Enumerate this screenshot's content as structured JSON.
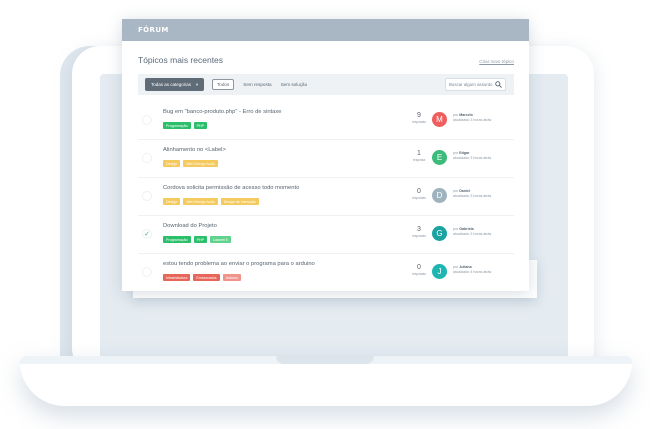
{
  "forum": {
    "title": "FÓRUM",
    "heading": "Tópicos mais recentes",
    "new_topic_link": "Criar novo tópico",
    "toolbar": {
      "category_select": "Todas as categorias",
      "filters": [
        "Todos",
        "Sem resposta",
        "Sem solução"
      ],
      "search_placeholder": "Buscar algum assunto"
    },
    "topics": [
      {
        "title": "Bug em \"banco-produto.php\" - Erro de sintaxe",
        "solved": false,
        "tags": [
          {
            "label": "Programação",
            "color": "#2bbf6a"
          },
          {
            "label": "PHP",
            "color": "#2bbf6a"
          }
        ],
        "count": "9",
        "count_label": "respostas",
        "avatar_letter": "M",
        "avatar_color": "#ef5e5e",
        "by_prefix": "por",
        "author": "Marcelo",
        "updated": "atualizado 3 horas atrás"
      },
      {
        "title": "Alinhamento no <Label>",
        "solved": false,
        "tags": [
          {
            "label": "Design",
            "color": "#f4c95d"
          },
          {
            "label": "Web Design Ação",
            "color": "#f4c95d"
          }
        ],
        "count": "1",
        "count_label": "resposta",
        "avatar_letter": "E",
        "avatar_color": "#3dbb7a",
        "by_prefix": "por",
        "author": "Edgar",
        "updated": "atualizado 3 horas atrás"
      },
      {
        "title": "Cordova solicita permissão de acesso todo momento",
        "solved": false,
        "tags": [
          {
            "label": "Design",
            "color": "#f4c95d"
          },
          {
            "label": "Web Design Ação",
            "color": "#f4c95d"
          },
          {
            "label": "Design de Interação",
            "color": "#f4c95d"
          }
        ],
        "count": "0",
        "count_label": "respostas",
        "avatar_letter": "D",
        "avatar_color": "#9fb3bf",
        "by_prefix": "por",
        "author": "Daniel",
        "updated": "atualizado 3 horas atrás"
      },
      {
        "title": "Download do Projeto",
        "solved": true,
        "tags": [
          {
            "label": "Programação",
            "color": "#2bbf6a"
          },
          {
            "label": "PHP",
            "color": "#2bbf6a"
          },
          {
            "label": "Laravel 5",
            "color": "#5fd38c"
          }
        ],
        "count": "3",
        "count_label": "respostas",
        "avatar_letter": "G",
        "avatar_color": "#1aa3a0",
        "by_prefix": "por",
        "author": "Gabriela",
        "updated": "atualizado 3 horas atrás"
      },
      {
        "title": "estou tendo problema ao enviar o programa para o arduino",
        "solved": false,
        "tags": [
          {
            "label": "Infraestrutura",
            "color": "#e7665a"
          },
          {
            "label": "Embarcados",
            "color": "#e7665a"
          },
          {
            "label": "Arduino",
            "color": "#ee948b"
          }
        ],
        "count": "0",
        "count_label": "respostas",
        "avatar_letter": "J",
        "avatar_color": "#1fb5b0",
        "by_prefix": "por",
        "author": "Juliana",
        "updated": "atualizado 4 horas atrás"
      }
    ]
  }
}
